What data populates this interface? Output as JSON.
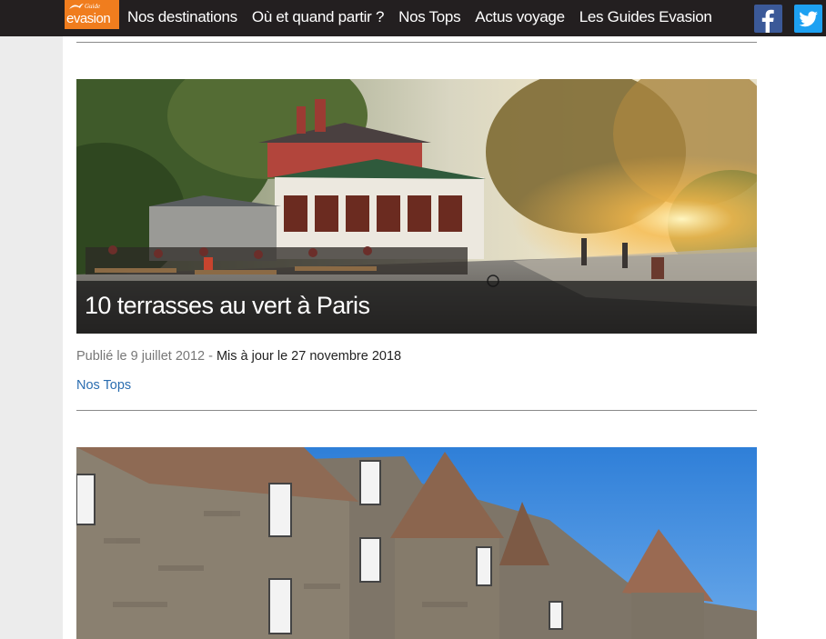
{
  "header": {
    "logo": {
      "guide_text": "Guide",
      "brand_text": "evasion"
    },
    "nav": [
      {
        "label": "Nos destinations"
      },
      {
        "label": "Où et quand partir ?"
      },
      {
        "label": "Nos Tops"
      },
      {
        "label": "Actus voyage"
      },
      {
        "label": "Les Guides Evasion"
      }
    ],
    "social": {
      "facebook_icon": "facebook-icon",
      "twitter_icon": "twitter-icon"
    }
  },
  "articles": [
    {
      "title": "10 terrasses au vert à Paris",
      "published": "Publié le 9 juillet 2012",
      "separator": " - ",
      "updated": "Mis à jour le 27 novembre 2018",
      "category": "Nos Tops"
    }
  ],
  "colors": {
    "topbar": "#231f20",
    "logo": "#f07d1e",
    "facebook": "#3b5998",
    "twitter": "#1da1f2",
    "link": "#2a6db0"
  }
}
